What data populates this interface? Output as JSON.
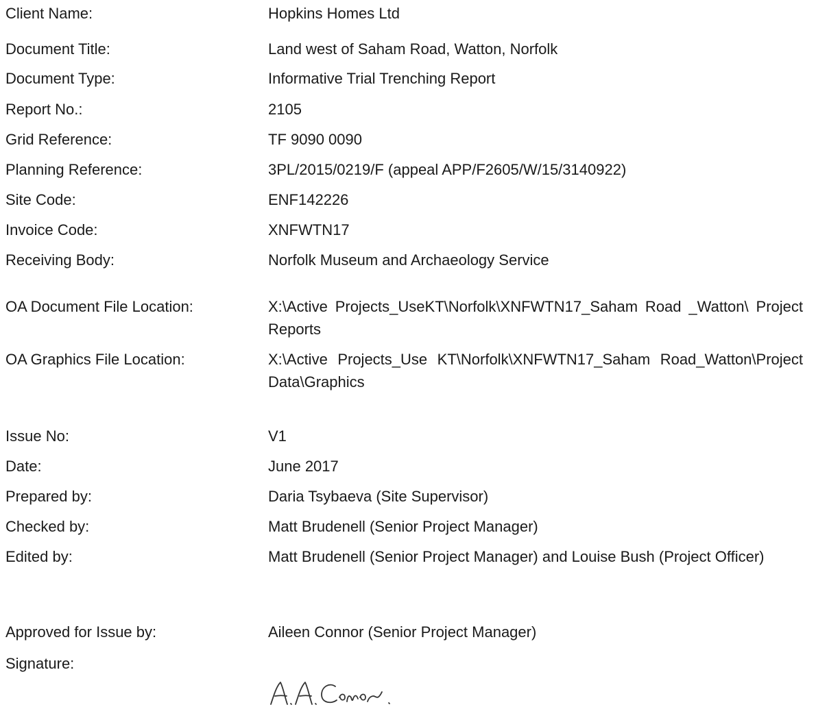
{
  "rows": [
    {
      "label": "Client Name:",
      "value": "Hopkins Homes Ltd"
    },
    {
      "label": "Document Title:",
      "value": "Land west of Saham Road, Watton, Norfolk"
    },
    {
      "label": "Document Type:",
      "value": "Informative Trial Trenching Report"
    },
    {
      "label": "Report No.:",
      "value": "2105"
    },
    {
      "label": "Grid Reference:",
      "value": "TF 9090 0090"
    },
    {
      "label": "Planning Reference:",
      "value": "3PL/2015/0219/F (appeal APP/F2605/W/15/3140922)"
    },
    {
      "label": "Site Code:",
      "value": "ENF142226"
    },
    {
      "label": "Invoice Code:",
      "value": "XNFWTN17"
    },
    {
      "label": "Receiving Body:",
      "value": "Norfolk Museum and Archaeology Service"
    },
    {
      "label": "OA Document File Location:",
      "value": "X:\\Active Projects_UseKT\\Norfolk\\XNFWTN17_Saham Road _Watton\\ Project Reports"
    },
    {
      "label": "OA Graphics File Location:",
      "value": "X:\\Active Projects_Use KT\\Norfolk\\XNFWTN17_Saham Road_Watton\\Project Data\\Graphics"
    },
    {
      "label": "Issue No:",
      "value": "V1"
    },
    {
      "label": "Date:",
      "value": "June 2017"
    },
    {
      "label": "Prepared by:",
      "value": "Daria Tsybaeva (Site Supervisor)"
    },
    {
      "label": "Checked by:",
      "value": "Matt Brudenell (Senior Project Manager)"
    },
    {
      "label": "Edited by:",
      "value": "Matt Brudenell  (Senior Project Manager) and Louise Bush (Project Officer)"
    },
    {
      "label": "Approved for Issue by:",
      "value": "Aileen Connor (Senior Project Manager)"
    },
    {
      "label": "Signature:",
      "value": ""
    }
  ],
  "signature_text": "A.A. Conor."
}
